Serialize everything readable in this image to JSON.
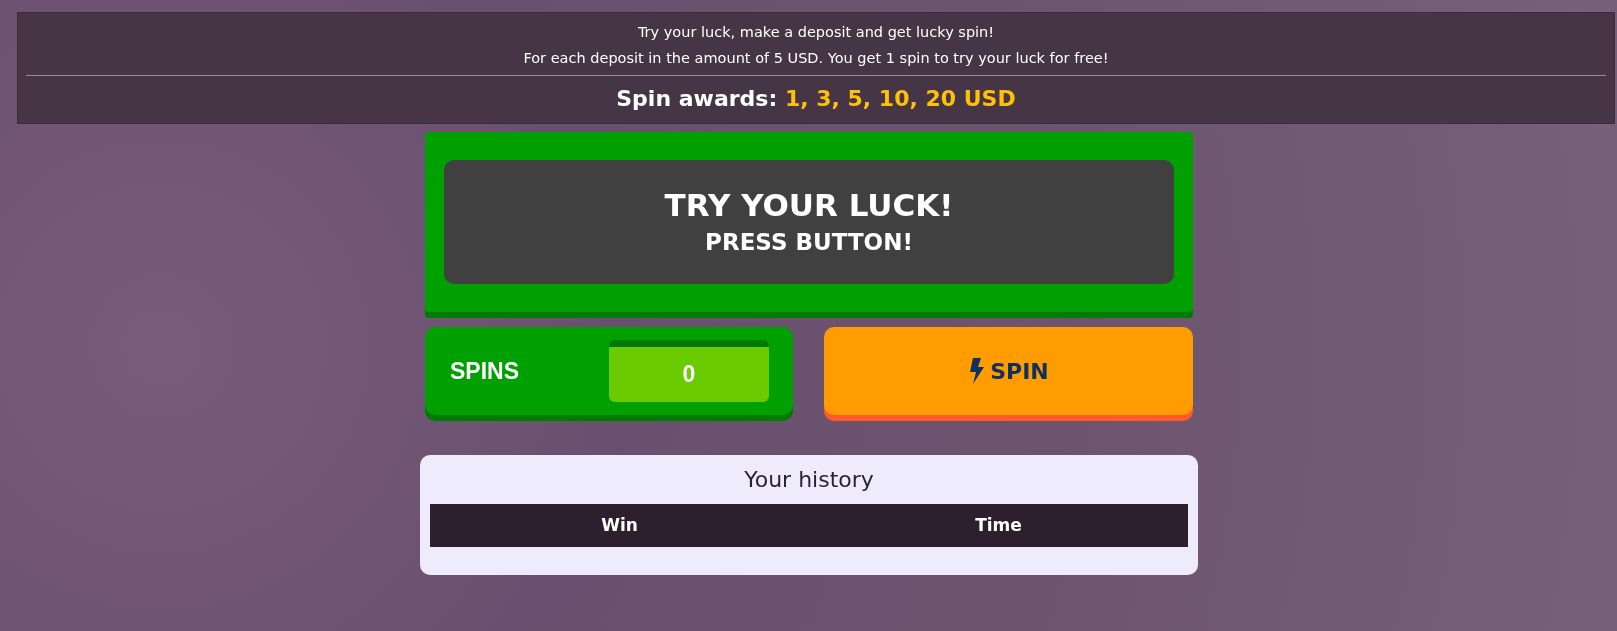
{
  "banner": {
    "lines": [
      "Try your luck, make a deposit and get lucky spin!",
      "For each deposit in the amount of 5 USD. You get 1 spin to try your luck for free!"
    ],
    "awards_label": "Spin awards:",
    "awards_values": "1, 3, 5, 10, 20 USD"
  },
  "display": {
    "title": "TRY YOUR LUCK!",
    "subtitle": "PRESS BUTTON!"
  },
  "spins": {
    "label": "SPINS",
    "count": "0"
  },
  "spin_button": {
    "label": "SPIN"
  },
  "history": {
    "title": "Your history",
    "columns": [
      "Win",
      "Time"
    ]
  }
}
